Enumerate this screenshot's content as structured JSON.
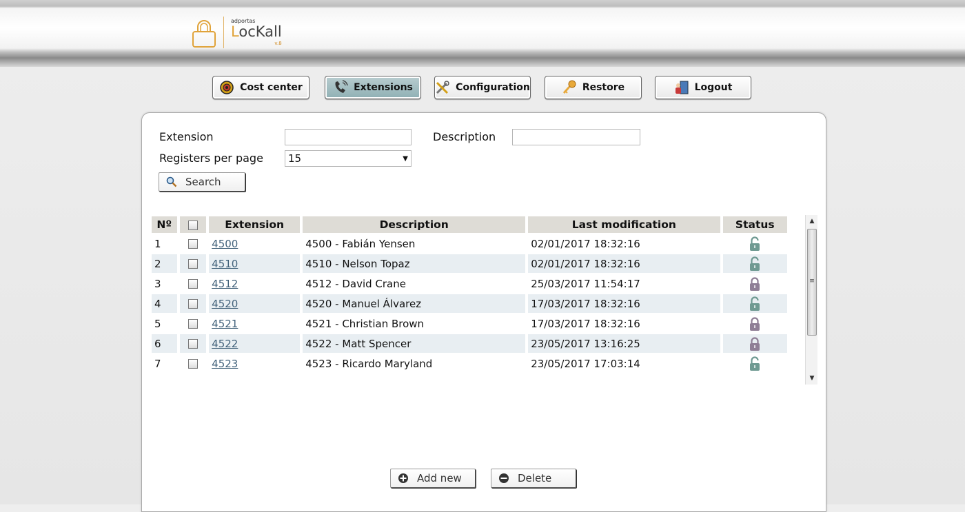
{
  "brand": {
    "small": "adportas",
    "name_first": "L",
    "name_rest": "ocKall",
    "version": "v.8"
  },
  "nav": [
    {
      "label": "Cost center",
      "icon": "cost-center-icon"
    },
    {
      "label": "Extensions",
      "icon": "phone-icon",
      "active": true
    },
    {
      "label": "Configuration",
      "icon": "tools-icon"
    },
    {
      "label": "Restore",
      "icon": "key-icon"
    },
    {
      "label": "Logout",
      "icon": "logout-icon"
    }
  ],
  "filters": {
    "extension_label": "Extension",
    "extension_value": "",
    "description_label": "Description",
    "description_value": "",
    "registers_label": "Registers per page",
    "registers_value": "15",
    "search_label": "Search"
  },
  "table": {
    "headers": {
      "num": "Nº",
      "extension": "Extension",
      "description": "Description",
      "last_mod": "Last modification",
      "status": "Status"
    },
    "rows": [
      {
        "num": "1",
        "extension": "4500",
        "description": "4500 - Fabián Yensen",
        "last_mod": "02/01/2017 18:32:16",
        "status": "unlocked"
      },
      {
        "num": "2",
        "extension": "4510",
        "description": "4510 - Nelson Topaz",
        "last_mod": "02/01/2017 18:32:16",
        "status": "unlocked"
      },
      {
        "num": "3",
        "extension": "4512",
        "description": "4512 - David Crane",
        "last_mod": "25/03/2017 11:54:17",
        "status": "locked"
      },
      {
        "num": "4",
        "extension": "4520",
        "description": "4520 - Manuel Álvarez",
        "last_mod": "17/03/2017 18:32:16",
        "status": "unlocked"
      },
      {
        "num": "5",
        "extension": "4521",
        "description": "4521 - Christian Brown",
        "last_mod": "17/03/2017 18:32:16",
        "status": "locked"
      },
      {
        "num": "6",
        "extension": "4522",
        "description": "4522 - Matt Spencer",
        "last_mod": "23/05/2017 13:16:25",
        "status": "locked"
      },
      {
        "num": "7",
        "extension": "4523",
        "description": "4523 - Ricardo Maryland",
        "last_mod": "23/05/2017 17:03:14",
        "status": "unlocked"
      }
    ]
  },
  "actions": {
    "add_label": "Add new",
    "delete_label": "Delete"
  },
  "colors": {
    "unlocked": "#6f9a92",
    "locked": "#8f7f96",
    "link": "#41617a",
    "logo_accent": "#e0a33a"
  }
}
